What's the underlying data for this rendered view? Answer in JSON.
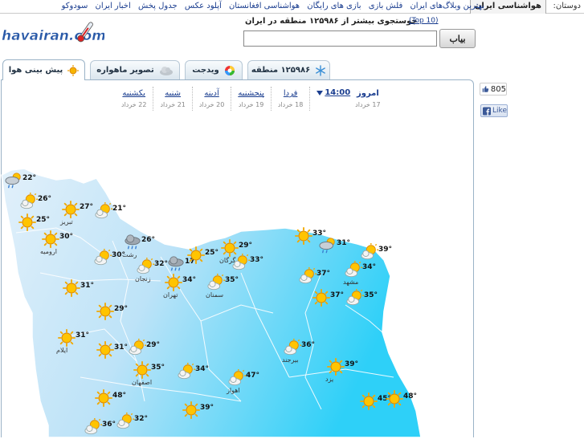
{
  "topbar": {
    "label": "دوستان:",
    "current": "هواشناسی ایران",
    "links": [
      "بهترین وبلاگ‌های ایران",
      "فلش بازی",
      "بازی های رایگان",
      "هواشناسی افغانستان",
      "آپلود عکس",
      "جدول پخش",
      "اخبار ایران",
      "سودوکو"
    ]
  },
  "logo": {
    "text": "havairan.com"
  },
  "search": {
    "title": "جوستجوی بیشتر از ۱۲۵۹۸۶ منطقه در ایران",
    "top10": "(Top 10)",
    "value": "",
    "button": "بیاب"
  },
  "tabs": [
    {
      "label": "پیش بینی هوا",
      "icon": "sun-icon",
      "active": true
    },
    {
      "label": "تصویر ماهواره",
      "icon": "cloud-icon",
      "active": false
    },
    {
      "label": "ویدجت",
      "icon": "widget-icon",
      "active": false
    },
    {
      "label": "۱۲۵۹۸۶ منطقه",
      "icon": "snowflake-icon",
      "active": false
    }
  ],
  "days": {
    "time": "14:00",
    "today": {
      "name": "امروز",
      "date": "17 خرداد"
    },
    "list": [
      {
        "name": "فردا",
        "date": "18 خرداد"
      },
      {
        "name": "پنجشنبه",
        "date": "19 خرداد"
      },
      {
        "name": "آدینه",
        "date": "20 خرداد"
      },
      {
        "name": "شنبه",
        "date": "21 خرداد"
      },
      {
        "name": "یکشنبه",
        "date": "22 خرداد"
      }
    ]
  },
  "social": {
    "like_count": "805",
    "like_label": "Like"
  },
  "colors": {
    "sea": "#ffffff",
    "land_light": "#cde6f7",
    "land_dark": "#2fd0f7",
    "border": "#ffffff",
    "link": "#1a3d8f"
  },
  "cities": [
    {
      "temp": "22°",
      "icon": "storm",
      "name": ""
    },
    {
      "temp": "26°",
      "icon": "partly",
      "name": ""
    },
    {
      "temp": "25°",
      "icon": "sun",
      "name": ""
    },
    {
      "temp": "27°",
      "icon": "sun",
      "name": "تبریز"
    },
    {
      "temp": "30°",
      "icon": "sun",
      "name": "ارومیه"
    },
    {
      "temp": "21°",
      "icon": "partly",
      "name": ""
    },
    {
      "temp": "30°",
      "icon": "partly",
      "name": ""
    },
    {
      "temp": "26°",
      "icon": "rain",
      "name": "رشت"
    },
    {
      "temp": "32°",
      "icon": "partly",
      "name": "زنجان"
    },
    {
      "temp": "17°",
      "icon": "rain",
      "name": ""
    },
    {
      "temp": "25°",
      "icon": "sun",
      "name": ""
    },
    {
      "temp": "29°",
      "icon": "sun",
      "name": "گرگان"
    },
    {
      "temp": "33°",
      "icon": "partly",
      "name": ""
    },
    {
      "temp": "33°",
      "icon": "sun",
      "name": ""
    },
    {
      "temp": "31°",
      "icon": "storm",
      "name": ""
    },
    {
      "temp": "39°",
      "icon": "partly",
      "name": ""
    },
    {
      "temp": "34°",
      "icon": "partly",
      "name": "مشهد"
    },
    {
      "temp": "31°",
      "icon": "sun",
      "name": ""
    },
    {
      "temp": "34°",
      "icon": "sun",
      "name": "تهران"
    },
    {
      "temp": "35°",
      "icon": "partly",
      "name": "سمنان"
    },
    {
      "temp": "37°",
      "icon": "partly",
      "name": ""
    },
    {
      "temp": "37°",
      "icon": "sun",
      "name": ""
    },
    {
      "temp": "35°",
      "icon": "partly",
      "name": ""
    },
    {
      "temp": "29°",
      "icon": "sun",
      "name": ""
    },
    {
      "temp": "31°",
      "icon": "sun",
      "name": "ایلام"
    },
    {
      "temp": "29°",
      "icon": "partly",
      "name": ""
    },
    {
      "temp": "31°",
      "icon": "sun",
      "name": ""
    },
    {
      "temp": "35°",
      "icon": "sun",
      "name": "اصفهان"
    },
    {
      "temp": "34°",
      "icon": "partly",
      "name": ""
    },
    {
      "temp": "36°",
      "icon": "partly",
      "name": "بیرجند"
    },
    {
      "temp": "39°",
      "icon": "sun",
      "name": "یزد"
    },
    {
      "temp": "47°",
      "icon": "partly",
      "name": "اهواز"
    },
    {
      "temp": "48°",
      "icon": "sun",
      "name": ""
    },
    {
      "temp": "32°",
      "icon": "partly",
      "name": ""
    },
    {
      "temp": "39°",
      "icon": "sun",
      "name": ""
    },
    {
      "temp": "45°",
      "icon": "sun",
      "name": ""
    },
    {
      "temp": "48°",
      "icon": "sun",
      "name": ""
    },
    {
      "temp": "36°",
      "icon": "partly",
      "name": ""
    }
  ]
}
